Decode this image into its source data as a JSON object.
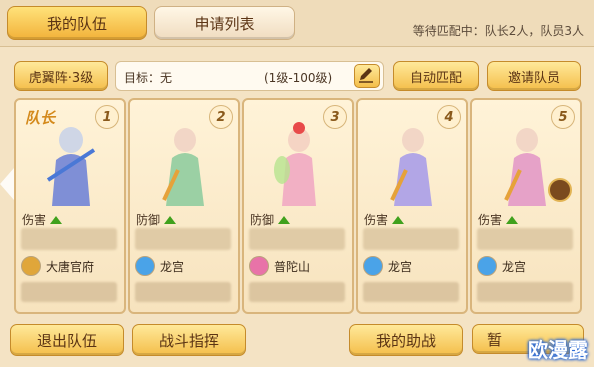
{
  "tabs": {
    "my_team": "我的队伍",
    "apply_list": "申请列表"
  },
  "status_text": "等待匹配中：队长2人，队员3人",
  "formation_button": "虎翼阵·3级",
  "target": {
    "label": "目标：无",
    "range": "(1级-100级)"
  },
  "auto_match_button": "自动匹配",
  "invite_button": "邀请队员",
  "leader_label": "队长",
  "members": [
    {
      "slot": "1",
      "role": "伤害",
      "school": "大唐官府",
      "school_color": "#e0a63a"
    },
    {
      "slot": "2",
      "role": "防御",
      "school": "龙宫",
      "school_color": "#4aa3e8"
    },
    {
      "slot": "3",
      "role": "防御",
      "school": "普陀山",
      "school_color": "#e873a8"
    },
    {
      "slot": "4",
      "role": "伤害",
      "school": "龙宫",
      "school_color": "#4aa3e8"
    },
    {
      "slot": "5",
      "role": "伤害",
      "school": "龙宫",
      "school_color": "#4aa3e8"
    }
  ],
  "bottom_buttons": {
    "leave": "退出队伍",
    "command": "战斗指挥",
    "assist": "我的助战",
    "pause": "暂"
  },
  "watermark": "欧漫露"
}
